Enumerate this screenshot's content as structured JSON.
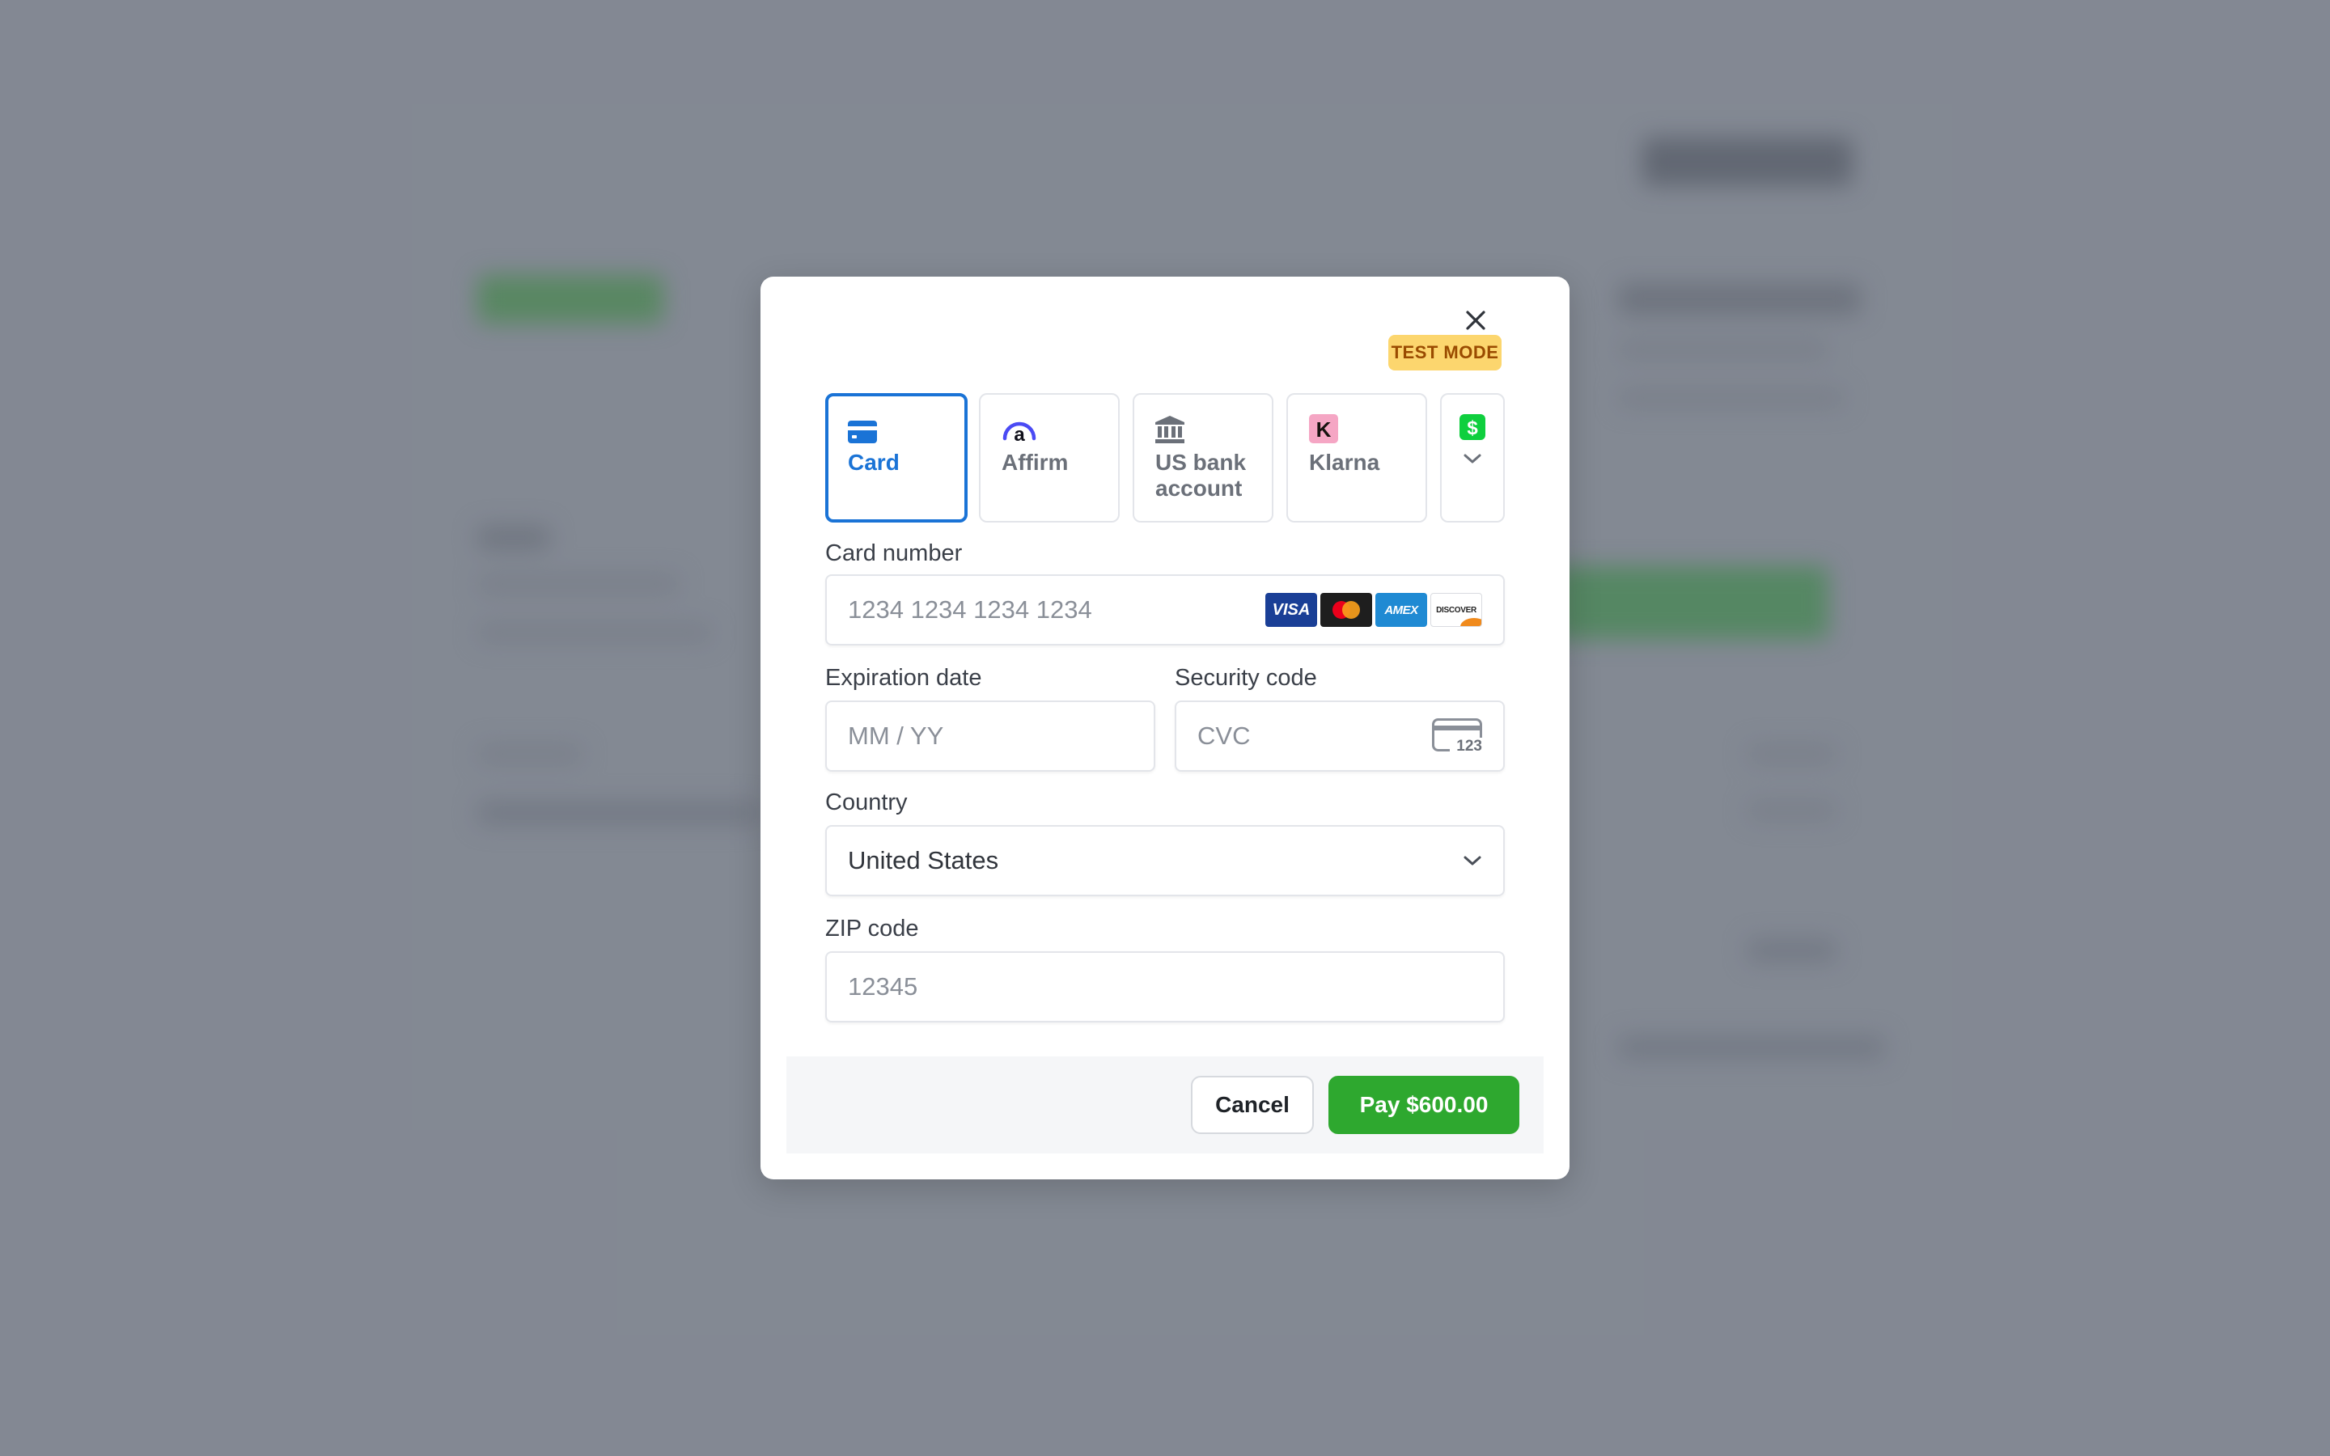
{
  "modal": {
    "badge": "TEST MODE",
    "tabs": [
      {
        "label": "Card",
        "icon": "card-icon"
      },
      {
        "label": "Affirm",
        "icon": "affirm-icon"
      },
      {
        "label": "US bank account",
        "icon": "bank-icon"
      },
      {
        "label": "Klarna",
        "icon": "klarna-icon"
      },
      {
        "label": "",
        "icon": "cash-app-icon"
      }
    ],
    "card_number": {
      "label": "Card number",
      "placeholder": "1234 1234 1234 1234"
    },
    "card_brands": [
      "VISA",
      "Mastercard",
      "AMEX",
      "DISCOVER"
    ],
    "expiration": {
      "label": "Expiration date",
      "placeholder": "MM / YY"
    },
    "security": {
      "label": "Security code",
      "placeholder": "CVC",
      "icon_text": "123"
    },
    "country": {
      "label": "Country",
      "value": "United States"
    },
    "zip": {
      "label": "ZIP code",
      "placeholder": "12345"
    },
    "cancel_label": "Cancel",
    "pay_label": "Pay $600.00"
  },
  "colors": {
    "accent": "#1a73d6",
    "pay_green": "#2ea82f",
    "badge_bg": "#fcd66e",
    "badge_text": "#9a4b00",
    "backdrop": "#878c96"
  }
}
